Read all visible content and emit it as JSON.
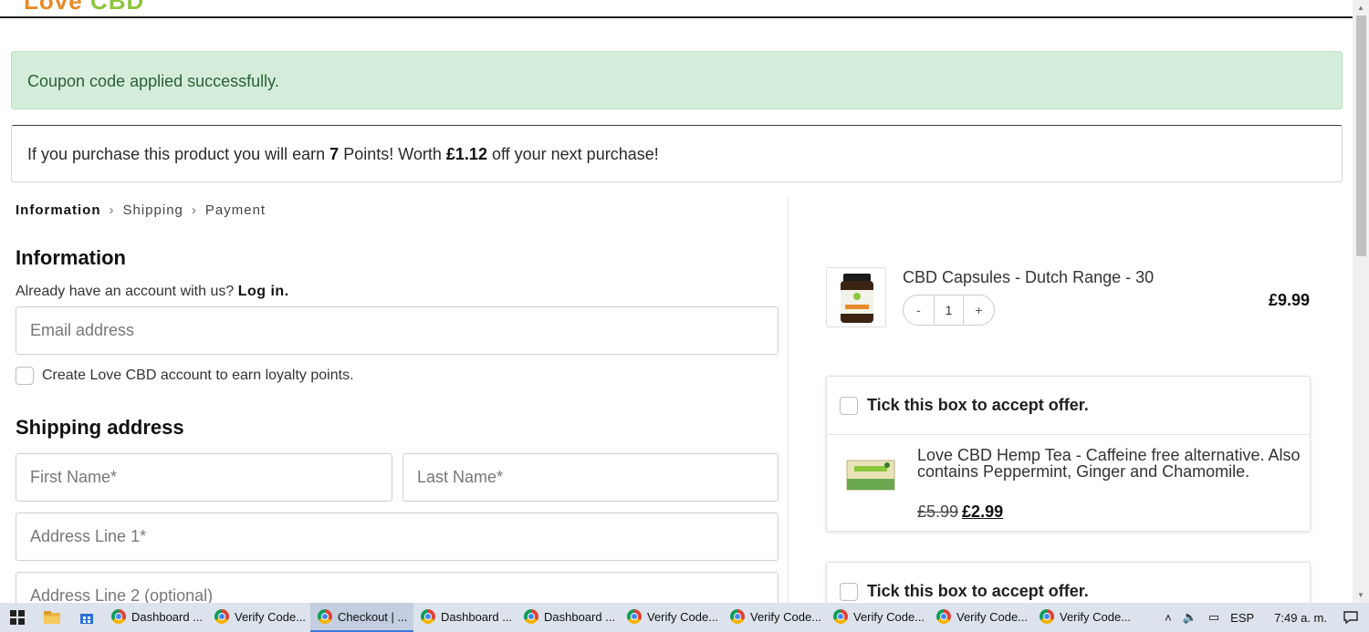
{
  "header": {
    "logo_part1": "Love",
    "logo_part2": "CBD"
  },
  "alerts": {
    "success": "Coupon code applied successfully.",
    "points_prefix": "If you purchase this product you will earn ",
    "points_value": "7",
    "points_middle": " Points! Worth ",
    "points_money": "£1.12",
    "points_suffix": " off your next purchase!"
  },
  "breadcrumb": {
    "step1": "Information",
    "step2": "Shipping",
    "step3": "Payment",
    "separator": "›"
  },
  "information": {
    "title": "Information",
    "account_prompt": "Already have an account with us?",
    "login_label": "Log in.",
    "email_placeholder": "Email address",
    "create_account_label": "Create Love CBD account to earn loyalty points."
  },
  "shipping": {
    "title": "Shipping address",
    "first_name_placeholder": "First Name*",
    "last_name_placeholder": "Last Name*",
    "address1_placeholder": "Address Line 1*",
    "address2_placeholder": "Address Line 2 (optional)"
  },
  "cart": {
    "product_name": "CBD Capsules - Dutch Range - 30",
    "qty_minus": "-",
    "qty_value": "1",
    "qty_plus": "+",
    "price": "£9.99"
  },
  "offers": [
    {
      "label": "Tick this box to accept offer.",
      "description": "Love CBD Hemp Tea - Caffeine free alternative. Also contains Peppermint, Ginger and Chamomile.",
      "old_price": "£5.99",
      "new_price": "£2.99"
    },
    {
      "label": "Tick this box to accept offer."
    }
  ],
  "taskbar": {
    "apps": [
      "Dashboard ...",
      "Verify Code...",
      "Checkout | ...",
      "Dashboard ...",
      "Dashboard ...",
      "Verify Code...",
      "Verify Code...",
      "Verify Code...",
      "Verify Code...",
      "Verify Code..."
    ],
    "active_index": 2,
    "language": "ESP",
    "time": "7:49 a. m."
  },
  "colors": {
    "success_bg": "#d4eddb",
    "logo_orange": "#e98a2a",
    "logo_green": "#8cc63f",
    "taskbar_bg": "#dde3ec"
  }
}
